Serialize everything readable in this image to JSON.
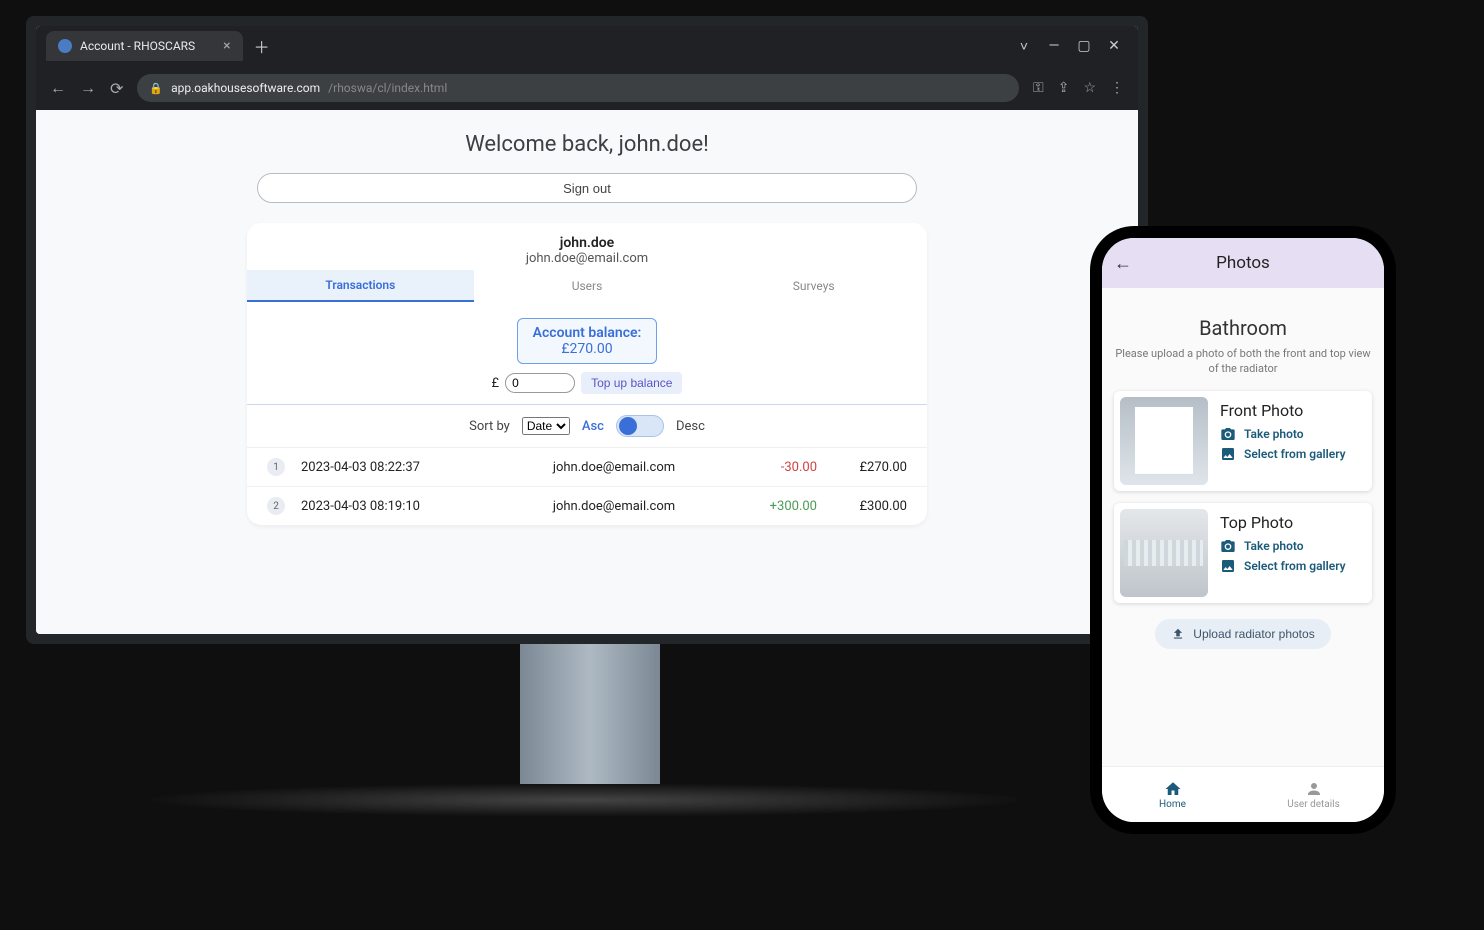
{
  "browser": {
    "tab_title": "Account - RHOSCARS",
    "url_host": "app.oakhousesoftware.com",
    "url_path": "/rhoswa/cl/index.html"
  },
  "app": {
    "welcome": "Welcome back, john.doe!",
    "signout": "Sign out",
    "user": {
      "name": "john.doe",
      "email": "john.doe@email.com"
    },
    "tabs": {
      "transactions": "Transactions",
      "users": "Users",
      "surveys": "Surveys"
    },
    "balance": {
      "label": "Account balance:",
      "value": "£270.00"
    },
    "topup": {
      "currency": "£",
      "input_value": "0",
      "button": "Top up balance"
    },
    "sort": {
      "label": "Sort by",
      "select_value": "Date",
      "asc": "Asc",
      "desc": "Desc"
    },
    "transactions": [
      {
        "idx": "1",
        "ts": "2023-04-03 08:22:37",
        "who": "john.doe@email.com",
        "amount": "-30.00",
        "amount_sign": "neg",
        "balance": "£270.00"
      },
      {
        "idx": "2",
        "ts": "2023-04-03 08:19:10",
        "who": "john.doe@email.com",
        "amount": "+300.00",
        "amount_sign": "pos",
        "balance": "£300.00"
      }
    ]
  },
  "phone": {
    "header": "Photos",
    "room": "Bathroom",
    "instruction": "Please upload a photo of both the front and top view of the radiator",
    "cards": {
      "front": {
        "title": "Front Photo",
        "take": "Take photo",
        "gallery": "Select from gallery"
      },
      "top": {
        "title": "Top Photo",
        "take": "Take photo",
        "gallery": "Select from gallery"
      }
    },
    "upload": "Upload radiator photos",
    "nav": {
      "home": "Home",
      "user": "User details"
    }
  }
}
